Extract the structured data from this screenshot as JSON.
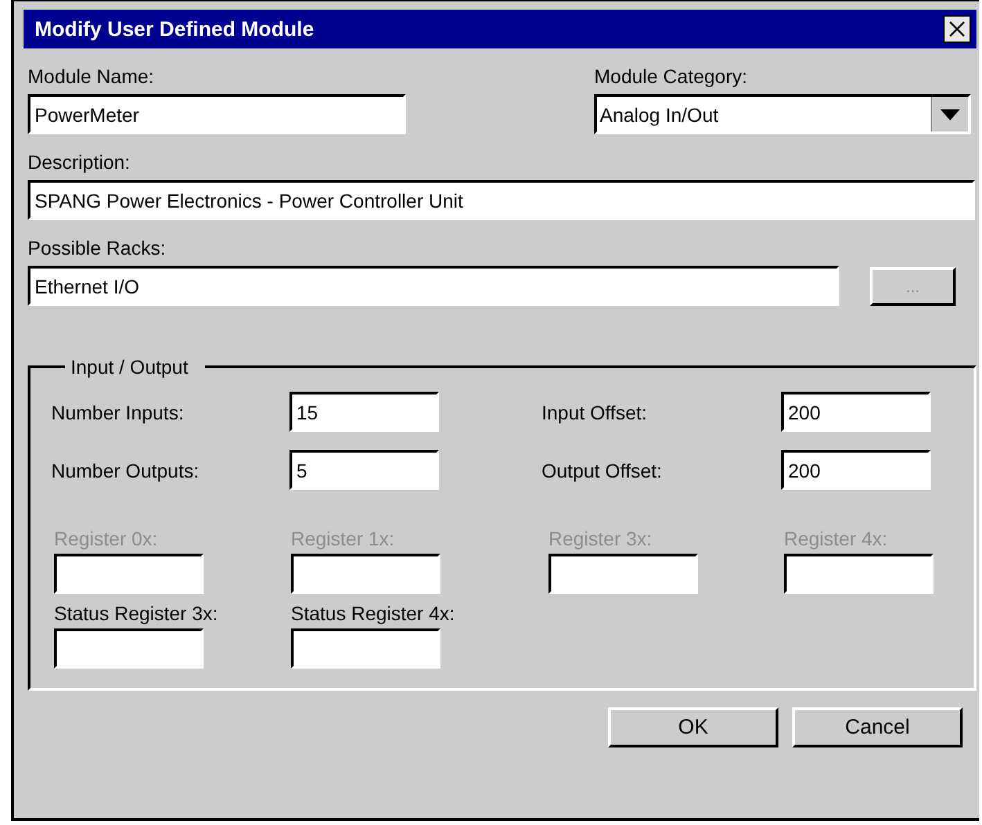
{
  "window": {
    "title": "Modify User Defined Module"
  },
  "module_name": {
    "label": "Module Name:",
    "value": "PowerMeter"
  },
  "module_category": {
    "label": "Module Category:",
    "value": "Analog In/Out"
  },
  "description": {
    "label": "Description:",
    "value": "SPANG Power Electronics - Power Controller Unit"
  },
  "possible_racks": {
    "label": "Possible Racks:",
    "value": "Ethernet I/O",
    "browse_button": "..."
  },
  "input_output": {
    "title": "Input / Output",
    "fields": [
      {
        "label": "Number Inputs:",
        "value": "15"
      },
      {
        "label": "Input Offset:",
        "value": "200"
      },
      {
        "label": "Number Outputs:",
        "value": "5"
      },
      {
        "label": "Output Offset:",
        "value": "200"
      }
    ],
    "registers": [
      {
        "label": "Register 0x:",
        "disabled": true
      },
      {
        "label": "Register 1x:",
        "disabled": true
      },
      {
        "label": "Register 3x:",
        "disabled": true
      },
      {
        "label": "Register 4x:",
        "disabled": true
      },
      {
        "label": "Status Register 3x:",
        "disabled": false
      },
      {
        "label": "Status Register 4x:",
        "disabled": false
      }
    ]
  },
  "buttons": [
    "OK",
    "Cancel"
  ]
}
